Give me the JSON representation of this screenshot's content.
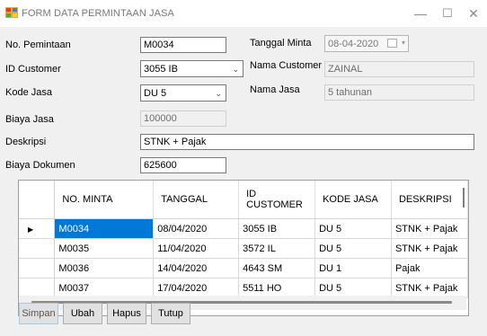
{
  "window": {
    "title": "FORM DATA PERMINTAAN JASA",
    "minimize": "—",
    "maximize": "☐",
    "close": "✕"
  },
  "form": {
    "no_permintaan_label": "No. Pemintaan",
    "no_permintaan_value": "M0034",
    "id_customer_label": "ID Customer",
    "id_customer_value": "3055 IB",
    "kode_jasa_label": "Kode Jasa",
    "kode_jasa_value": "DU 5",
    "biaya_jasa_label": "Biaya Jasa",
    "biaya_jasa_value": "100000",
    "deskripsi_label": "Deskripsi",
    "deskripsi_value": "STNK + Pajak",
    "biaya_dokumen_label": "Biaya Dokumen",
    "biaya_dokumen_value": "625600",
    "tanggal_minta_label": "Tanggal Minta",
    "tanggal_minta_value": "08-04-2020",
    "nama_customer_label": "Nama Customer",
    "nama_customer_value": "ZAINAL",
    "nama_jasa_label": "Nama Jasa",
    "nama_jasa_value": "5 tahunan"
  },
  "grid": {
    "columns": [
      "NO. MINTA",
      "TANGGAL",
      "ID\nCUSTOMER",
      "KODE JASA",
      "DESKRIPSI"
    ],
    "rows": [
      {
        "no_minta": "M0034",
        "tanggal": "08/04/2020",
        "id_customer": "3055 IB",
        "kode_jasa": "DU 5",
        "deskripsi": "STNK + Pajak"
      },
      {
        "no_minta": "M0035",
        "tanggal": "11/04/2020",
        "id_customer": "3572 IL",
        "kode_jasa": "DU 5",
        "deskripsi": "STNK + Pajak"
      },
      {
        "no_minta": "M0036",
        "tanggal": "14/04/2020",
        "id_customer": "4643 SM",
        "kode_jasa": "DU 1",
        "deskripsi": "Pajak"
      },
      {
        "no_minta": "M0037",
        "tanggal": "17/04/2020",
        "id_customer": "5511 HO",
        "kode_jasa": "DU 5",
        "deskripsi": "STNK + Pajak"
      }
    ],
    "current_row_marker": "▶"
  },
  "buttons": {
    "simpan": "Simpan",
    "ubah": "Ubah",
    "hapus": "Hapus",
    "tutup": "Tutup"
  },
  "colors": {
    "selection": "#0078d7",
    "form_bg": "#f0f0f0"
  },
  "icons": {
    "app": "form-window-icon",
    "dropdown": "chevron-down-icon",
    "calendar": "calendar-icon"
  }
}
